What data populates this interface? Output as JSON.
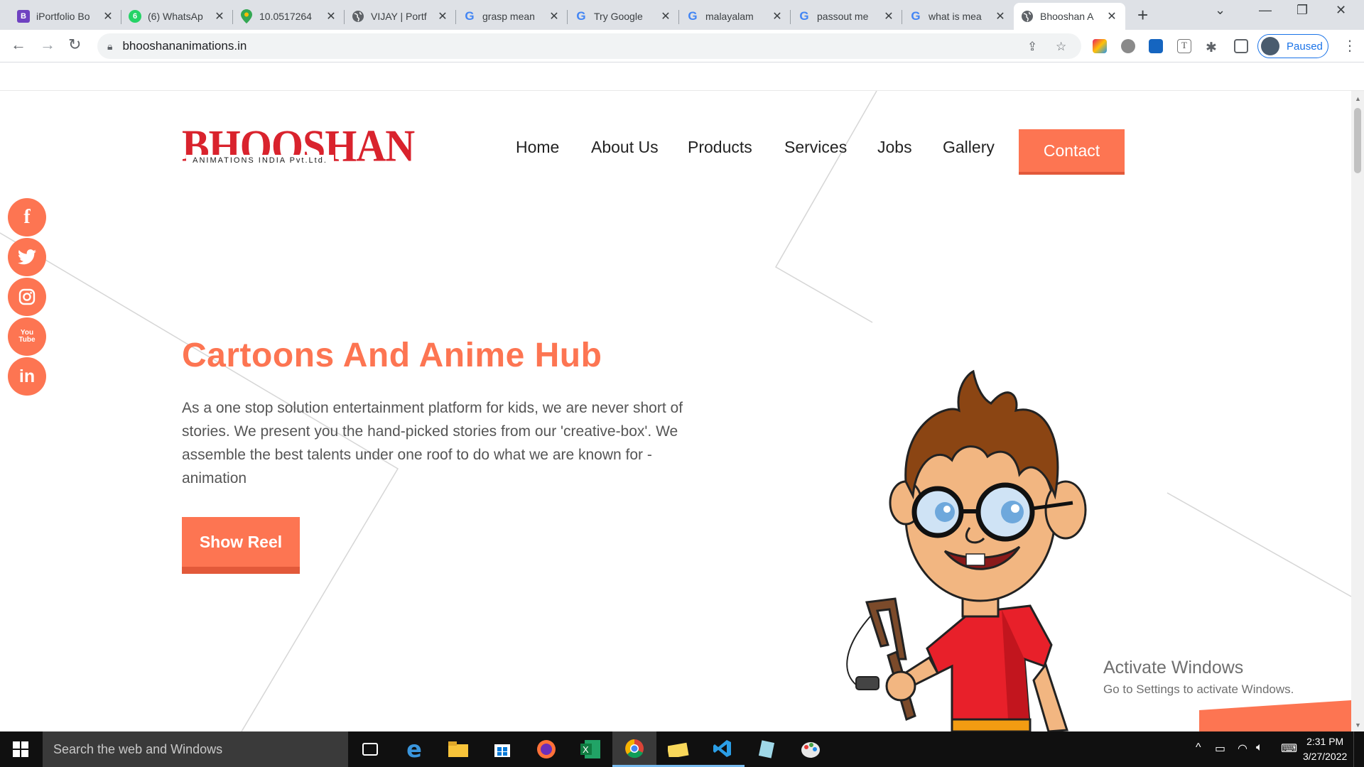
{
  "browser": {
    "tabs": [
      {
        "title": "iPortfolio Bo",
        "fav_text": "B",
        "fav_color": "#6f42c1"
      },
      {
        "title": "(6) WhatsAp",
        "fav_text": "6",
        "fav_color": "#25d366"
      },
      {
        "title": "10.0517264",
        "fav_text": "",
        "fav_color": "#34a853"
      },
      {
        "title": "VIJAY | Portf",
        "fav_text": "",
        "fav_color": "#5f6368"
      },
      {
        "title": "grasp mean",
        "fav_text": "G",
        "fav_color": "#4285f4"
      },
      {
        "title": "Try Google",
        "fav_text": "G",
        "fav_color": "#4285f4"
      },
      {
        "title": "malayalam",
        "fav_text": "G",
        "fav_color": "#4285f4"
      },
      {
        "title": "passout me",
        "fav_text": "G",
        "fav_color": "#4285f4"
      },
      {
        "title": "what is mea",
        "fav_text": "G",
        "fav_color": "#4285f4"
      },
      {
        "title": "Bhooshan A",
        "fav_text": "",
        "fav_color": "#5f6368",
        "active": true
      }
    ],
    "url": "bhooshananimations.in",
    "profile_label": "Paused"
  },
  "site": {
    "logo_main": "BHOOSHAN",
    "logo_sub": "ANIMATIONS INDIA Pvt.Ltd.",
    "nav": [
      "Home",
      "About Us",
      "Products",
      "Services",
      "Jobs",
      "Gallery"
    ],
    "contact_label": "Contact",
    "social": [
      "f",
      "t",
      "ig",
      "You Tube",
      "in"
    ],
    "hero_title": "Cartoons And Anime Hub",
    "hero_text": "As a one stop solution entertainment platform for kids, we are never short of stories. We present you the hand-picked stories from our 'creative-box'. We assemble the best talents under one roof to do what we are known for -animation",
    "show_reel_label": "Show Reel",
    "accent_color": "#fd7552"
  },
  "watermark": {
    "title": "Activate Windows",
    "subtitle": "Go to Settings to activate Windows."
  },
  "taskbar": {
    "search_placeholder": "Search the web and Windows",
    "time": "2:31 PM",
    "date": "3/27/2022"
  }
}
